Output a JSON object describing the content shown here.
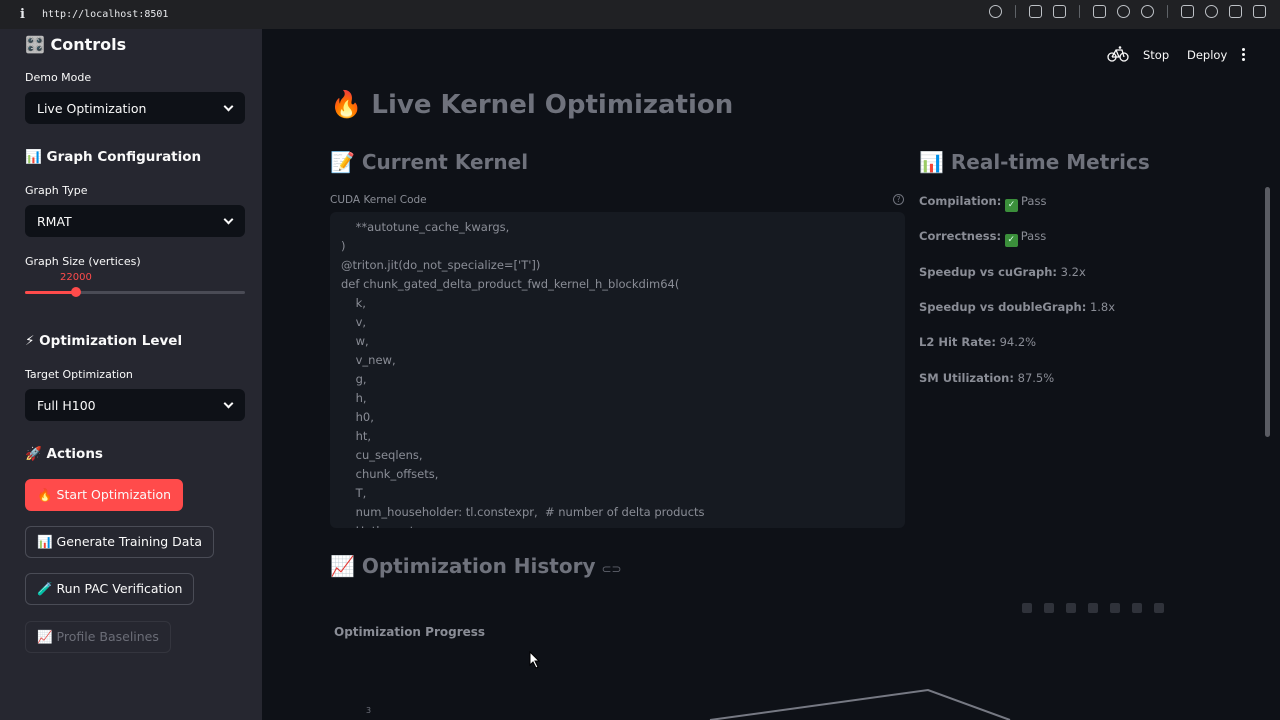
{
  "browser": {
    "url": "http://localhost:8501"
  },
  "sidebar": {
    "controls_title": "🎛️ Controls",
    "demo_mode": {
      "label": "Demo Mode",
      "value": "Live Optimization"
    },
    "graph_config_title": "📊 Graph Configuration",
    "graph_type": {
      "label": "Graph Type",
      "value": "RMAT"
    },
    "graph_size": {
      "label": "Graph Size (vertices)",
      "value": "22000",
      "fraction": 0.23
    },
    "optimization_level_title": "⚡ Optimization Level",
    "target_optimization": {
      "label": "Target Optimization",
      "value": "Full H100"
    },
    "actions_title": "🚀 Actions",
    "buttons": {
      "start": "🔥 Start Optimization",
      "generate": "📊 Generate Training Data",
      "pac": "🧪 Run PAC Verification",
      "profile": "📈 Profile Baselines"
    }
  },
  "header": {
    "stop": "Stop",
    "deploy": "Deploy"
  },
  "main": {
    "title": "🔥 Live Kernel Optimization",
    "current_kernel_title": "📝 Current Kernel",
    "code_label": "CUDA Kernel Code",
    "code_lines": [
      "    **autotune_cache_kwargs,",
      ")",
      "@triton.jit(do_not_specialize=['T'])",
      "def chunk_gated_delta_product_fwd_kernel_h_blockdim64(",
      "    k,",
      "    v,",
      "    w,",
      "    v_new,",
      "    g,",
      "    h,",
      "    h0,",
      "    ht,",
      "    cu_seqlens,",
      "    chunk_offsets,",
      "    T,",
      "    num_householder: tl.constexpr,  # number of delta products",
      "    H: tl.constexpr,"
    ],
    "metrics_title": "📊 Real-time Metrics",
    "metrics": [
      {
        "label": "Compilation:",
        "value": "Pass",
        "check": true
      },
      {
        "label": "Correctness:",
        "value": "Pass",
        "check": true
      },
      {
        "label": "Speedup vs cuGraph:",
        "value": "3.2x",
        "check": false
      },
      {
        "label": "Speedup vs doubleGraph:",
        "value": "1.8x",
        "check": false
      },
      {
        "label": "L2 Hit Rate:",
        "value": "94.2%",
        "check": false
      },
      {
        "label": "SM Utilization:",
        "value": "87.5%",
        "check": false
      }
    ],
    "history_title": "📈 Optimization History",
    "chart_title": "Optimization Progress",
    "chart_tick": "3"
  }
}
